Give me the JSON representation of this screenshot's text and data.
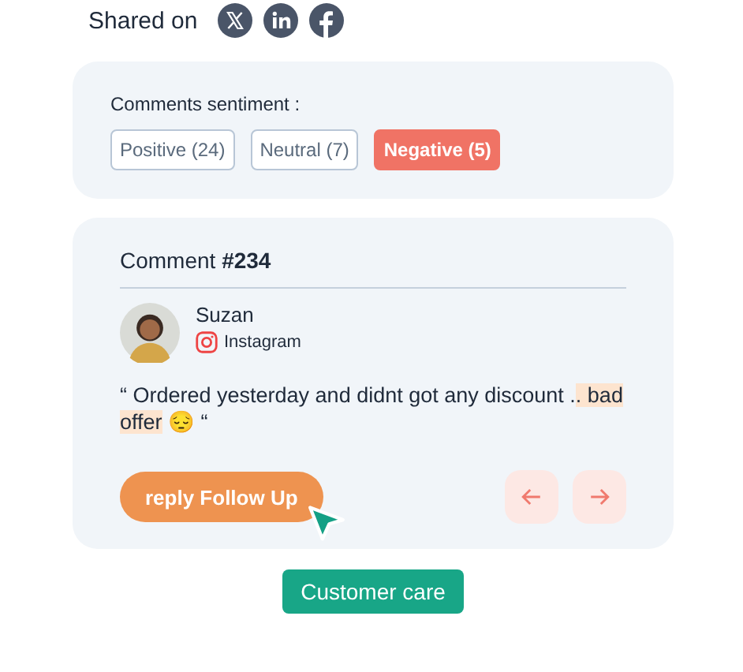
{
  "shared": {
    "label": "Shared on",
    "networks": [
      {
        "kind": "x"
      },
      {
        "kind": "linkedin"
      },
      {
        "kind": "facebook"
      }
    ]
  },
  "sentiment": {
    "title": "Comments sentiment :",
    "filters": [
      {
        "label": "Positive (24)",
        "selected": false
      },
      {
        "label": "Neutral (7)",
        "selected": false
      },
      {
        "label": "Negative (5)",
        "selected": true
      }
    ]
  },
  "comment": {
    "title": "Comment **#234**",
    "author": "Suzan",
    "source": "Instagram",
    "text_before": "“ Ordered yesterday and didnt got any discount .",
    "highlight": ". bad offer",
    "text_after": " 😔 “",
    "action": "reply  Follow Up"
  },
  "footer_button": "Customer care"
}
